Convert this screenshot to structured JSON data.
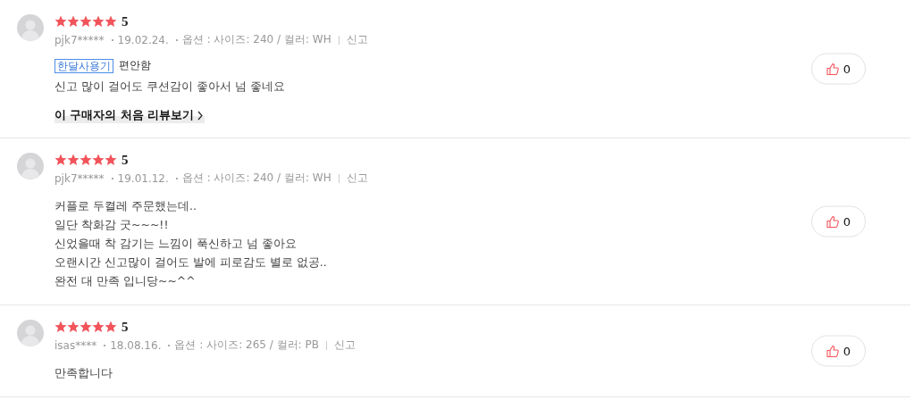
{
  "reviews": [
    {
      "stars": 5,
      "score": "5",
      "user": "pjk7*****",
      "date": "19.02.24.",
      "option": "옵션 : 사이즈: 240 / 컬러: WH",
      "report": "신고",
      "tag": "한달사용기",
      "tag_text": "편안함",
      "body": "신고 많이 걸어도 쿠션감이 좋아서 넘 좋네요",
      "first_review_link": "이 구매자의 처음 리뷰보기",
      "likes": "0"
    },
    {
      "stars": 5,
      "score": "5",
      "user": "pjk7*****",
      "date": "19.01.12.",
      "option": "옵션 : 사이즈: 240 / 컬러: WH",
      "report": "신고",
      "body": "커플로 두켤레 주문했는데..\n일단 착화감 굿~~~!!\n신었을때 착 감기는 느낌이 푹신하고 넘 좋아요\n오랜시간 신고많이 걸어도 발에 피로감도 별로 없공..\n완전 대 만족 입니당~~^^",
      "likes": "0"
    },
    {
      "stars": 5,
      "score": "5",
      "user": "isas****",
      "date": "18.08.16.",
      "option": "옵션 : 사이즈: 265 / 컬러: PB",
      "report": "신고",
      "body": "만족합니다",
      "likes": "0"
    }
  ]
}
